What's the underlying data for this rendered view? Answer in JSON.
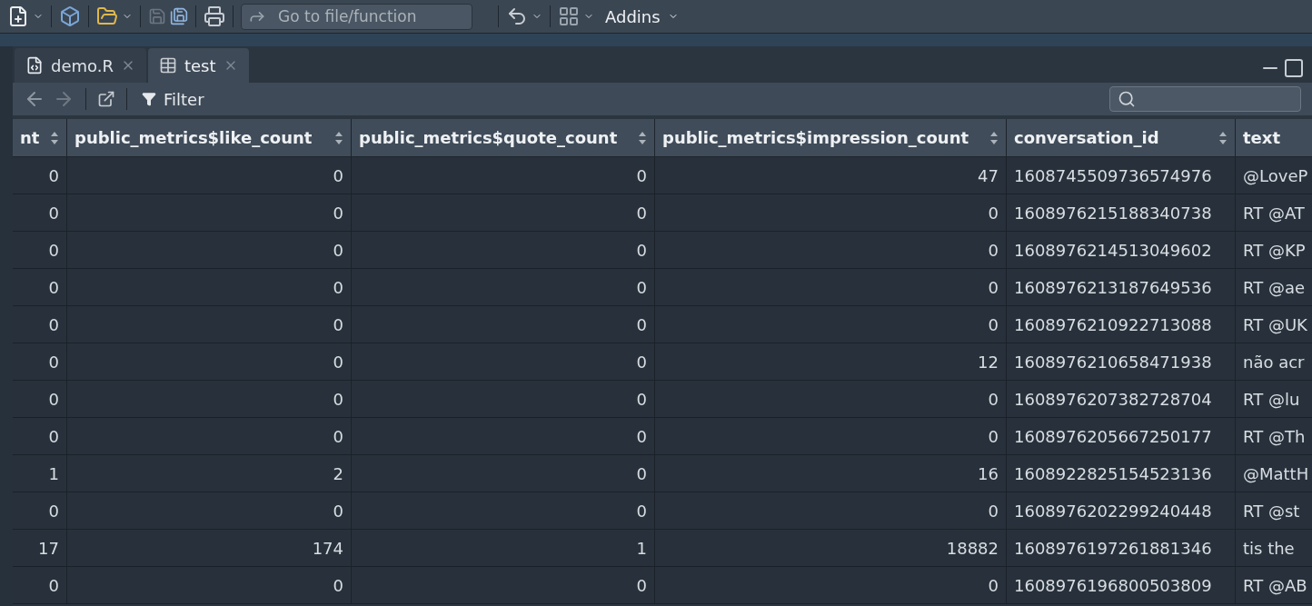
{
  "toolbar": {
    "goto_placeholder": "Go to file/function",
    "addins": "Addins"
  },
  "tabs": [
    {
      "label": "demo.R",
      "kind": "script",
      "selected": false
    },
    {
      "label": "test",
      "kind": "data",
      "selected": true
    }
  ],
  "viewer_toolbar": {
    "filter": "Filter"
  },
  "table": {
    "columns": [
      {
        "label": "nt",
        "sortable": true,
        "kind": "number"
      },
      {
        "label": "public_metrics$like_count",
        "sortable": true,
        "kind": "number"
      },
      {
        "label": "public_metrics$quote_count",
        "sortable": true,
        "kind": "number"
      },
      {
        "label": "public_metrics$impression_count",
        "sortable": true,
        "kind": "number"
      },
      {
        "label": "conversation_id",
        "sortable": true,
        "kind": "text"
      },
      {
        "label": "text",
        "sortable": false,
        "kind": "text"
      }
    ],
    "rows": [
      [
        "0",
        "0",
        "0",
        "47",
        "1608745509736574976",
        "@LoveP"
      ],
      [
        "0",
        "0",
        "0",
        "0",
        "1608976215188340738",
        "RT @AT"
      ],
      [
        "0",
        "0",
        "0",
        "0",
        "1608976214513049602",
        "RT @KP"
      ],
      [
        "0",
        "0",
        "0",
        "0",
        "1608976213187649536",
        "RT @ae"
      ],
      [
        "0",
        "0",
        "0",
        "0",
        "1608976210922713088",
        "RT @UK"
      ],
      [
        "0",
        "0",
        "0",
        "12",
        "1608976210658471938",
        "não acr"
      ],
      [
        "0",
        "0",
        "0",
        "0",
        "1608976207382728704",
        "RT @lu"
      ],
      [
        "0",
        "0",
        "0",
        "0",
        "1608976205667250177",
        "RT @Th"
      ],
      [
        "1",
        "2",
        "0",
        "16",
        "1608922825154523136",
        "@MattH"
      ],
      [
        "0",
        "0",
        "0",
        "0",
        "1608976202299240448",
        "RT @st"
      ],
      [
        "17",
        "174",
        "1",
        "18882",
        "1608976197261881346",
        "tis the"
      ],
      [
        "0",
        "0",
        "0",
        "0",
        "1608976196800503809",
        "RT @AB"
      ]
    ]
  }
}
